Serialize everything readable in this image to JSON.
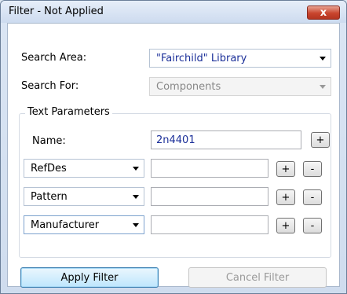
{
  "window": {
    "title": "Filter - Not Applied",
    "close_label": "x"
  },
  "search_area": {
    "label": "Search Area:",
    "value": "\"Fairchild\" Library"
  },
  "search_for": {
    "label": "Search For:",
    "value": "Components"
  },
  "text_parameters": {
    "title": "Text Parameters",
    "name_label": "Name:",
    "name_value": "2n4401",
    "rows": [
      {
        "field": "RefDes",
        "value": ""
      },
      {
        "field": "Pattern",
        "value": ""
      },
      {
        "field": "Manufacturer",
        "value": ""
      }
    ],
    "add_label": "+",
    "remove_label": "-"
  },
  "buttons": {
    "apply": "Apply Filter",
    "cancel": "Cancel Filter"
  },
  "colors": {
    "value_text": "#1b2f99",
    "accent": "#3c7fb1"
  }
}
